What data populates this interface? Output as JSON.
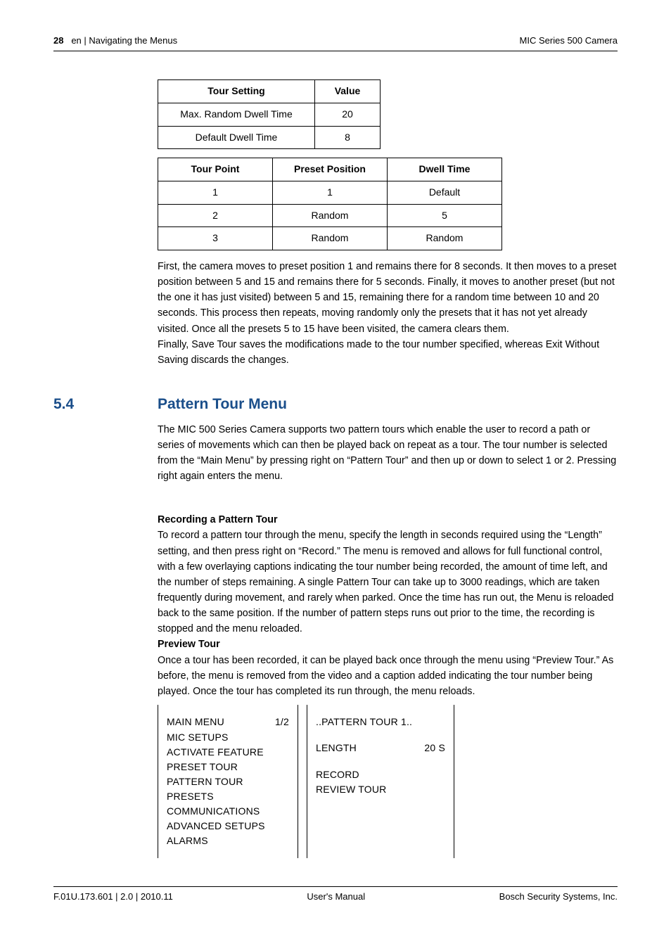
{
  "header": {
    "page_number": "28",
    "breadcrumb": "en | Navigating the Menus",
    "product": "MIC Series 500 Camera"
  },
  "table1": {
    "headers": [
      "Tour Setting",
      "Value"
    ],
    "rows": [
      [
        "Max. Random Dwell Time",
        "20"
      ],
      [
        "Default Dwell Time",
        "8"
      ]
    ]
  },
  "table2": {
    "headers": [
      "Tour Point",
      "Preset Position",
      "Dwell Time"
    ],
    "rows": [
      [
        "1",
        "1",
        "Default"
      ],
      [
        "2",
        "Random",
        "5"
      ],
      [
        "3",
        "Random",
        "Random"
      ]
    ]
  },
  "para1": "First, the camera moves to preset position 1 and remains there for 8 seconds. It then moves to a preset position between 5 and 15 and remains there for 5 seconds. Finally, it moves to another preset (but not the one it has just visited) between 5 and 15, remaining there for a random time between 10 and 20 seconds. This process then repeats, moving randomly only the presets that it has not yet already visited. Once all the presets 5 to 15 have been visited, the camera clears them.",
  "para2": "Finally, Save Tour saves the modifications made to the tour number specified, whereas Exit Without Saving discards the changes.",
  "section": {
    "number": "5.4",
    "title": "Pattern Tour Menu"
  },
  "para3": "The MIC 500 Series Camera supports two pattern tours which enable the user to record a path or series of movements which can then be played back on repeat as a tour. The tour number is selected from the “Main Menu” by pressing right on “Pattern Tour” and then up or down to select 1 or 2. Pressing right again enters the menu.",
  "sub1": "Recording a Pattern Tour",
  "para4": "To record a pattern tour through the menu, specify the length in seconds required using the “Length” setting, and then press right on “Record.” The menu is removed and allows for full functional control, with a few overlaying captions indicating the tour number being recorded, the amount of time left, and the number of steps remaining. A single Pattern Tour can take up to 3000 readings, which are taken frequently during movement, and rarely when parked. Once the time has run out, the Menu is reloaded back to the same position. If the number of pattern steps runs out prior to the time, the recording is stopped and the menu reloaded.",
  "sub2": "Preview Tour",
  "para5": "Once a tour has been recorded, it can be played back once through the menu using “Preview Tour.” As before, the menu is removed from the video and a caption added indicating the tour number being played. Once the tour has completed its run through, the menu reloads.",
  "menu_left": {
    "title": "MAIN MENU",
    "page": "1/2",
    "items": [
      "MIC SETUPS",
      "ACTIVATE FEATURE",
      "PRESET TOUR",
      "PATTERN TOUR",
      "PRESETS",
      "COMMUNICATIONS",
      "ADVANCED SETUPS",
      "ALARMS"
    ]
  },
  "menu_right": {
    "title": "..PATTERN TOUR 1..",
    "length_label": "LENGTH",
    "length_value": "20 S",
    "record": "RECORD",
    "review": "REVIEW TOUR"
  },
  "footer": {
    "left": "F.01U.173.601 | 2.0 | 2010.11",
    "center": "User's Manual",
    "right": "Bosch Security Systems, Inc."
  }
}
